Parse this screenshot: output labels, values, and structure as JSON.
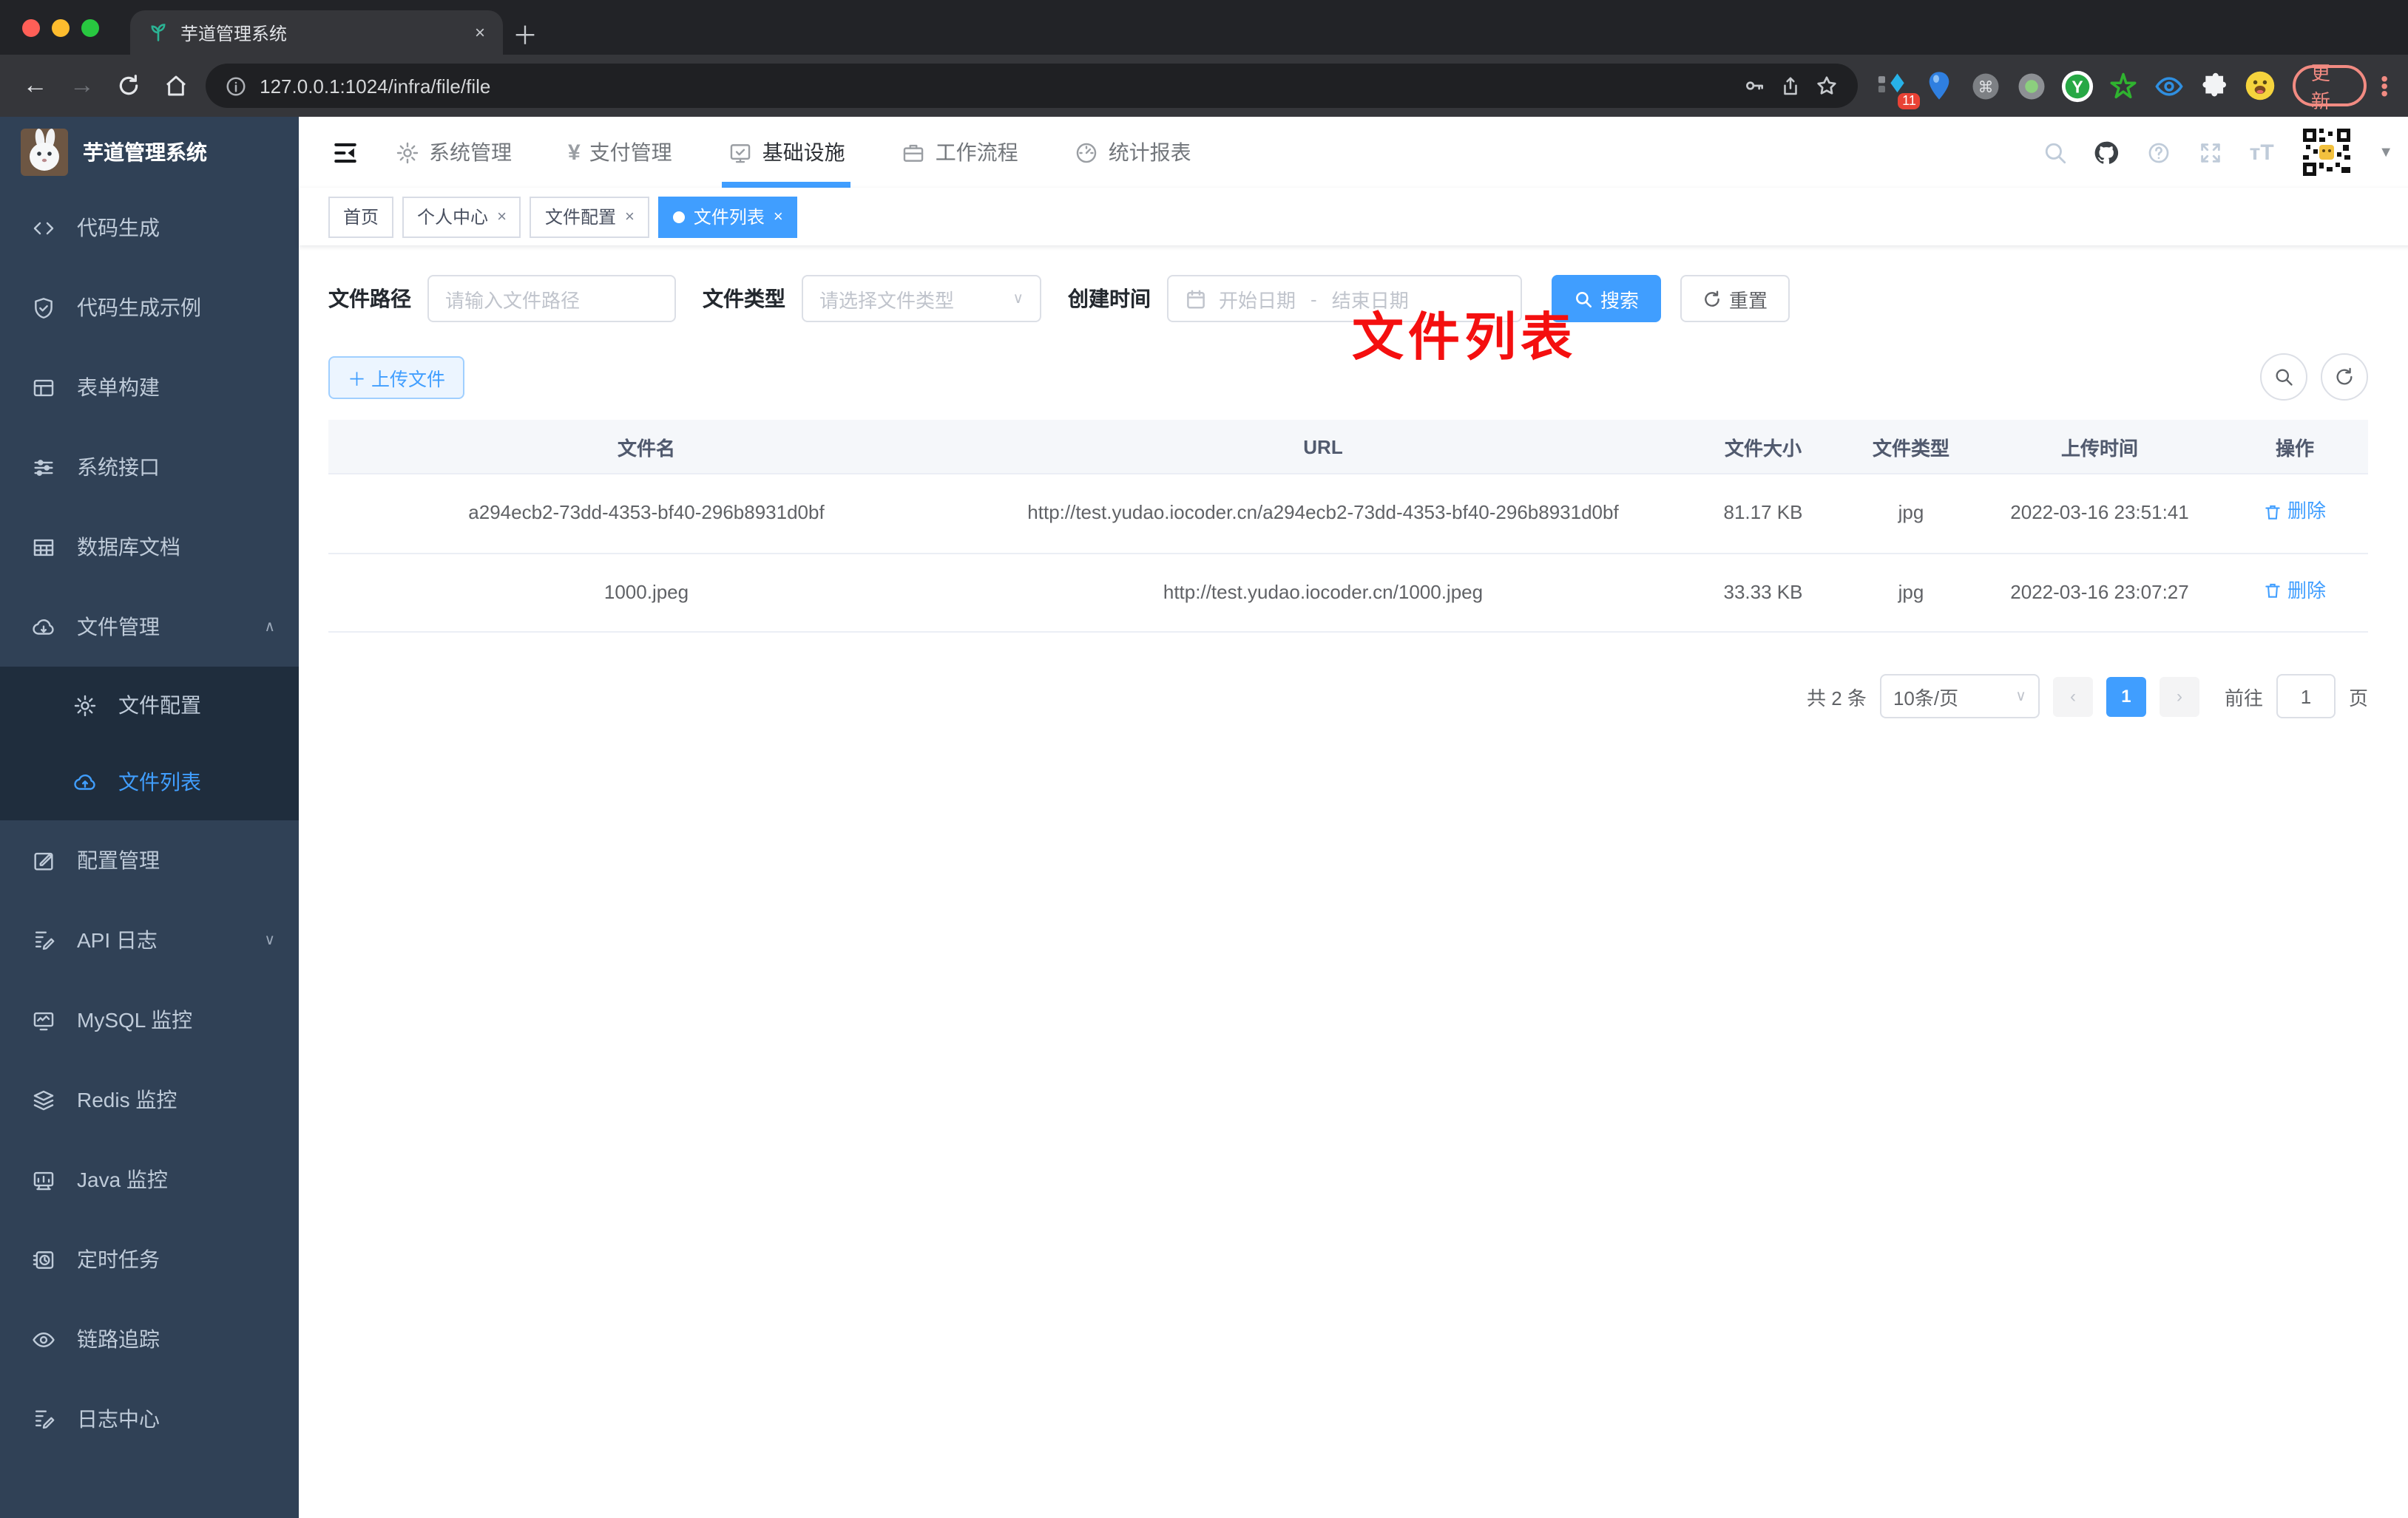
{
  "browser": {
    "tab_title": "芋道管理系统",
    "tab_favicon": "sprout-icon",
    "close_tab": "×",
    "url": "127.0.0.1:1024/infra/file/file",
    "traffic_lights": [
      "#ff5f57",
      "#febc2e",
      "#28c840"
    ],
    "omnibox_icons": [
      "info-icon",
      "key-icon",
      "share-icon",
      "star-icon"
    ],
    "extensions": [
      {
        "icon": "diamond-ext-icon",
        "badge": "11"
      },
      {
        "icon": "balloon-ext-icon"
      },
      {
        "icon": "cmd-ext-icon"
      },
      {
        "icon": "dot-ext-icon"
      },
      {
        "icon": "y-ext-icon"
      },
      {
        "icon": "star-ext-icon"
      },
      {
        "icon": "eye-ext-icon"
      },
      {
        "icon": "puzzle-ext-icon"
      },
      {
        "icon": "emoji-ext-icon"
      }
    ],
    "update_label": "更新"
  },
  "sidebar": {
    "title": "芋道管理系统",
    "items": [
      {
        "icon": "code-icon",
        "label": "代码生成"
      },
      {
        "icon": "shield-check-icon",
        "label": "代码生成示例"
      },
      {
        "icon": "form-grid-icon",
        "label": "表单构建"
      },
      {
        "icon": "sliders-icon",
        "label": "系统接口"
      },
      {
        "icon": "table-icon",
        "label": "数据库文档"
      },
      {
        "icon": "cloud-download-icon",
        "label": "文件管理",
        "chevron": "up"
      },
      {
        "icon": "gear-icon",
        "label": "文件配置",
        "sub": true
      },
      {
        "icon": "cloud-upload-icon",
        "label": "文件列表",
        "sub": true,
        "active": true
      },
      {
        "icon": "edit-square-icon",
        "label": "配置管理"
      },
      {
        "icon": "doc-edit-icon",
        "label": "API 日志",
        "chevron": "down"
      },
      {
        "icon": "monitor-chart-icon",
        "label": "MySQL 监控"
      },
      {
        "icon": "layers-icon",
        "label": "Redis 监控"
      },
      {
        "icon": "monitor-icon",
        "label": "Java 监控"
      },
      {
        "icon": "timer-icon",
        "label": "定时任务"
      },
      {
        "icon": "eye-icon",
        "label": "链路追踪"
      },
      {
        "icon": "doc-edit-icon",
        "label": "日志中心"
      }
    ]
  },
  "header": {
    "fold_icon": "menu-fold-icon",
    "menus": [
      {
        "icon": "gear-icon",
        "label": "系统管理"
      },
      {
        "icon": "yen-icon",
        "label": "支付管理"
      },
      {
        "icon": "monitor-check-icon",
        "label": "基础设施",
        "active": true
      },
      {
        "icon": "briefcase-icon",
        "label": "工作流程"
      },
      {
        "icon": "dashboard-icon",
        "label": "统计报表"
      }
    ],
    "right_icons": [
      "search-icon",
      "github-icon",
      "question-icon",
      "fullscreen-icon",
      "font-size-icon"
    ],
    "avatar": "qr-avatar"
  },
  "tags": [
    {
      "label": "首页",
      "closable": false
    },
    {
      "label": "个人中心",
      "closable": true
    },
    {
      "label": "文件配置",
      "closable": true
    },
    {
      "label": "文件列表",
      "closable": true,
      "active": true
    }
  ],
  "annotation": {
    "text": "文件列表",
    "color": "#f40f0f"
  },
  "filters": {
    "path_label": "文件路径",
    "path_placeholder": "请输入文件路径",
    "type_label": "文件类型",
    "type_placeholder": "请选择文件类型",
    "time_label": "创建时间",
    "start_placeholder": "开始日期",
    "range_separator": "-",
    "end_placeholder": "结束日期",
    "search_label": "搜索",
    "reset_label": "重置"
  },
  "toolbar": {
    "upload_label": "＋ 上传文件",
    "corner_icons": [
      "search-icon",
      "refresh-icon"
    ]
  },
  "table": {
    "columns": [
      "文件名",
      "URL",
      "文件大小",
      "文件类型",
      "上传时间",
      "操作"
    ],
    "rows": [
      {
        "name": "a294ecb2-73dd-4353-bf40-296b8931d0bf",
        "url": "http://test.yudao.iocoder.cn/a294ecb2-73dd-4353-bf40-296b8931d0bf",
        "size": "81.17 KB",
        "type": "jpg",
        "time": "2022-03-16 23:51:41",
        "action": "删除"
      },
      {
        "name": "1000.jpeg",
        "url": "http://test.yudao.iocoder.cn/1000.jpeg",
        "size": "33.33 KB",
        "type": "jpg",
        "time": "2022-03-16 23:07:27",
        "action": "删除"
      }
    ]
  },
  "pagination": {
    "total_text": "共 2 条",
    "page_size": "10条/页",
    "prev": "‹",
    "next": "›",
    "current_page": "1",
    "goto_label": "前往",
    "goto_value": "1",
    "page_unit": "页"
  },
  "colors": {
    "primary": "#409eff",
    "sidebar_bg": "#304156",
    "submenu_bg": "#1f2d3d"
  }
}
